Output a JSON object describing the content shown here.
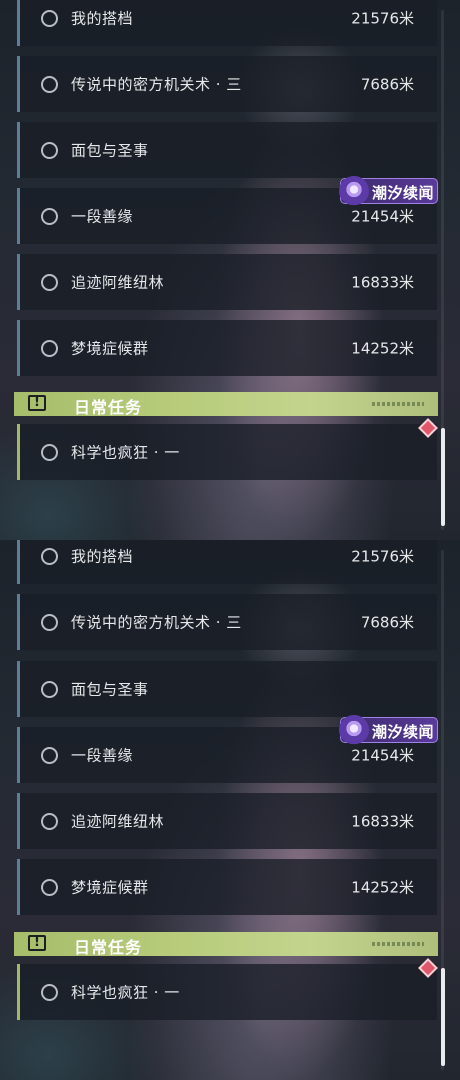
{
  "quests": [
    {
      "title": "我的搭档",
      "distance": "21576米"
    },
    {
      "title": "传说中的密方机关术 · 三",
      "distance": "7686米"
    },
    {
      "title": "面包与圣事",
      "distance": ""
    },
    {
      "title": "一段善缘",
      "distance": "21454米"
    },
    {
      "title": "追迹阿维纽林",
      "distance": "16833米"
    },
    {
      "title": "梦境症候群",
      "distance": "14252米"
    }
  ],
  "badge": {
    "label": "潮汐续闻",
    "icon": "tide-story-icon"
  },
  "daily_section": {
    "title": "日常任务",
    "icon": "warning-icon"
  },
  "daily_quests": [
    {
      "title": "科学也疯狂 · 一",
      "distance": ""
    }
  ],
  "colors": {
    "side_border": "#5b7f99",
    "daily_accent": "#a6bd6b",
    "badge_purple": "#5a3a9a",
    "marker_red": "#e0566a"
  }
}
